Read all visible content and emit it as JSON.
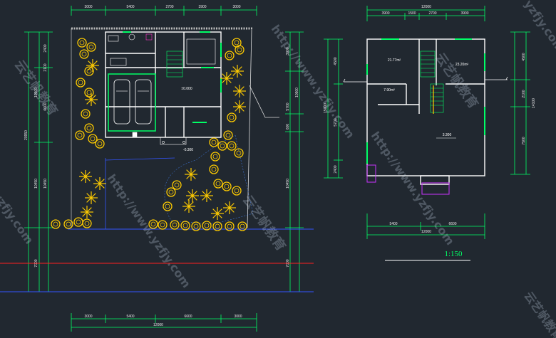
{
  "site_plan": {
    "top_dims": [
      "3000",
      "5400",
      "2700",
      "3900",
      "3000"
    ],
    "bottom_dims": [
      "3000",
      "5400",
      "6600",
      "3000"
    ],
    "bottom_total": "12000",
    "left_dims": [
      "2400",
      "2100",
      "10500",
      "6000",
      "20950",
      "10450",
      "10450",
      "7000"
    ],
    "right_dims": [
      "3900",
      "10500",
      "5700",
      "600",
      "10450",
      "7000"
    ],
    "level_floor": "±0.000",
    "level_yard": "-0.300"
  },
  "floor_plan": {
    "top_total": "12000",
    "top_dims": [
      "3900",
      "1500",
      "2700",
      "3900"
    ],
    "area_1": "21.77m²",
    "area_2": "23.20m²",
    "area_3": "7.90m²",
    "level": "3.300",
    "bottom_dims": [
      "5400",
      "6600"
    ],
    "bottom_total": "12000",
    "left_dims": [
      "4500",
      "15000",
      "5700",
      "2400"
    ],
    "right_dims": [
      "4500",
      "2100",
      "14100",
      "7500"
    ]
  },
  "scale_label": "1:150",
  "watermarks": [
    "云艺帆教育",
    "http://www.yzfjy.com",
    "yzfjy.com"
  ],
  "colors": {
    "background": "#212830",
    "wall": "#ffffff",
    "dimension": "#00ff66",
    "tree": "#ffcc00",
    "red_line": "#ff2020",
    "blue_line": "#3355ff",
    "magenta": "#cc33ff"
  }
}
